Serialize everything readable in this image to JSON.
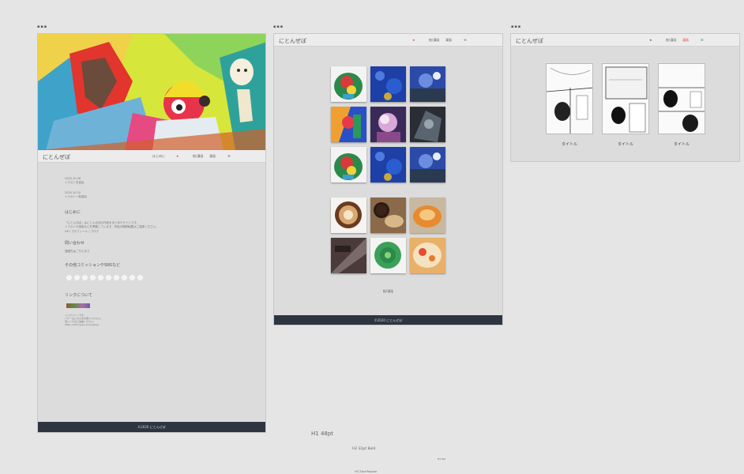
{
  "frames": {
    "frame_labels": [
      "▪▪▪",
      "▪▪▪",
      "▪▪▪"
    ]
  },
  "site": {
    "title": "にとんぜぽ",
    "nav": [
      {
        "label": "はじめに"
      },
      {
        "label": "★"
      },
      {
        "label": "絵/漫画"
      },
      {
        "label": "漫画"
      },
      {
        "label": "☰"
      }
    ],
    "footer": "©2020  にとんぜぽ"
  },
  "home": {
    "news": [
      {
        "date": "2020.10.26",
        "text": "イラストを追加"
      },
      {
        "date": "2020.10.20",
        "text": "イラスト一覧追加"
      }
    ],
    "about_heading": "はじめに",
    "about_text": [
      "「にとんぜぽ」はにとんぜぽの作品をまとめたサイトです。",
      "イラストや漫画などを掲載しています。作品の無断転載はご遠慮ください。",
      "HP / プロフィール / ブログ"
    ],
    "contact_heading": "問い合わせ",
    "contact_text": "連絡先はこちらまで",
    "sns_heading": "その他コミッションやSNSなど",
    "link_heading": "リンクについて",
    "link_text": [
      "リンクフリーです。",
      "バナーはこちらをお使いください。",
      "直リンクはご遠慮ください。",
      "https://nitonzepo.example.jp"
    ]
  },
  "gallery": {
    "more_label": "絵/漫画"
  },
  "manga": {
    "items": [
      {
        "title": "タイトル"
      },
      {
        "title": "タイトル"
      },
      {
        "title": "タイトル"
      }
    ]
  },
  "type_specs": {
    "h1": "H1 48pt",
    "h2": "H2 32pt Bold",
    "small": "H3 9pt",
    "body": "H3 24pt Regular"
  },
  "colors": {
    "accent": "#e84848",
    "footer_bg": "#2e3540",
    "canvas": "#e5e5e5"
  }
}
